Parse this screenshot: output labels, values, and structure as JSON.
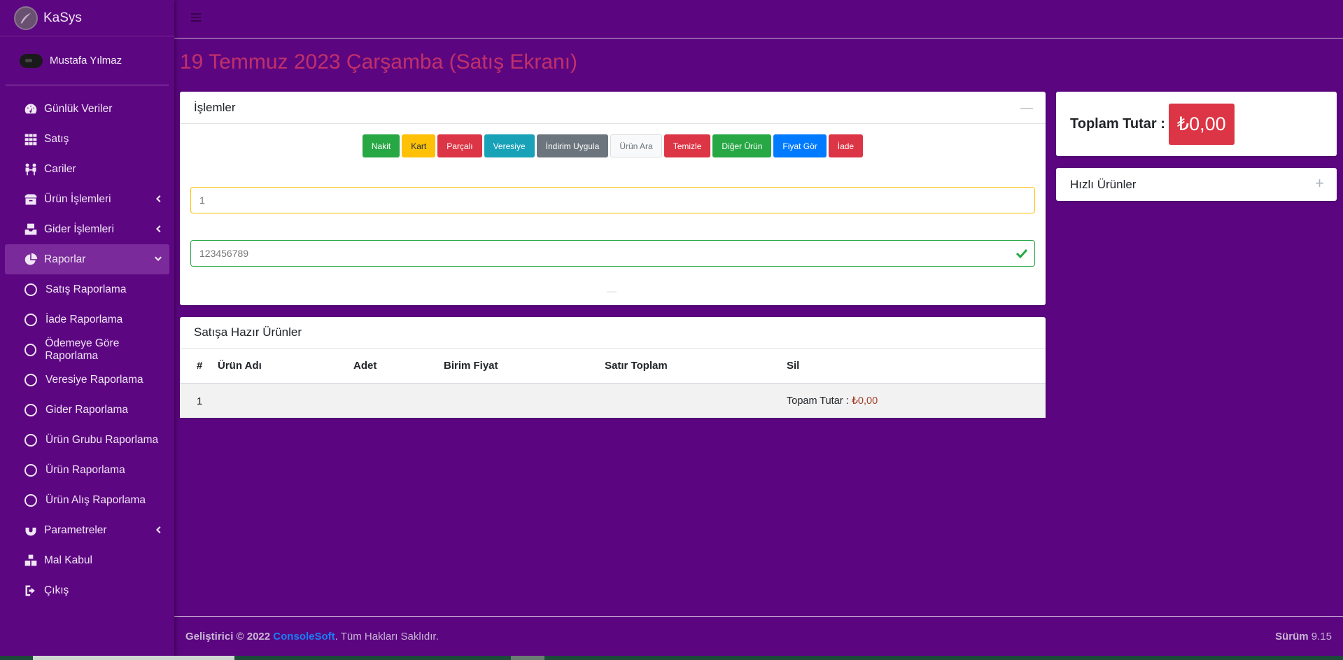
{
  "brand": {
    "name": "KaSys"
  },
  "user": {
    "name": "Mustafa Yılmaz"
  },
  "nav": [
    {
      "label": "Günlük Veriler",
      "icon": "dashboard-icon"
    },
    {
      "label": "Satış",
      "icon": "grid-icon"
    },
    {
      "label": "Cariler",
      "icon": "people-icon"
    },
    {
      "label": "Ürün İşlemleri",
      "icon": "box-icon",
      "has_children": true
    },
    {
      "label": "Gider İşlemleri",
      "icon": "tray-icon",
      "has_children": true
    },
    {
      "label": "Raporlar",
      "icon": "pie-chart-icon",
      "active": true,
      "expanded": true
    },
    {
      "label": "Satış Raporlama",
      "icon": "circle-icon"
    },
    {
      "label": "İade Raporlama",
      "icon": "circle-icon"
    },
    {
      "label": "Ödemeye Göre Raporlama",
      "icon": "circle-icon"
    },
    {
      "label": "Veresiye Raporlama",
      "icon": "circle-icon"
    },
    {
      "label": "Gider Raporlama",
      "icon": "circle-icon"
    },
    {
      "label": "Ürün Grubu Raporlama",
      "icon": "circle-icon"
    },
    {
      "label": "Ürün Raporlama",
      "icon": "circle-icon"
    },
    {
      "label": "Ürün Alış Raporlama",
      "icon": "circle-icon"
    },
    {
      "label": "Parametreler",
      "icon": "magnet-icon",
      "has_children": true
    },
    {
      "label": "Mal Kabul",
      "icon": "boxes-icon"
    },
    {
      "label": "Çıkış",
      "icon": "sign-out-icon"
    }
  ],
  "page": {
    "title": "19 Temmuz 2023 Çarşamba (Satış Ekranı)"
  },
  "islemler": {
    "title": "İşlemler",
    "buttons": [
      {
        "label": "Nakit",
        "style": "success"
      },
      {
        "label": "Kart",
        "style": "warning"
      },
      {
        "label": "Parçalı",
        "style": "danger"
      },
      {
        "label": "Veresiye",
        "style": "info"
      },
      {
        "label": "İndirim Uygula",
        "style": "secondary"
      },
      {
        "label": "Ürün Ara",
        "style": "light"
      },
      {
        "label": "Temizle",
        "style": "danger"
      },
      {
        "label": "Diğer Ürün",
        "style": "success"
      },
      {
        "label": "Fiyat Gör",
        "style": "primary"
      },
      {
        "label": "İade",
        "style": "danger"
      }
    ],
    "quantity_placeholder": "1",
    "barcode_placeholder": "123456789"
  },
  "ready_products": {
    "title": "Satışa Hazır Ürünler",
    "columns": [
      "#",
      "Ürün Adı",
      "Adet",
      "Birim Fiyat",
      "Satır Toplam",
      "Sil"
    ],
    "row_index": "1",
    "total_label": "Topam Tutar : ",
    "total_value": "₺0,00"
  },
  "total": {
    "label": "Toplam Tutar :",
    "value": "₺0,00"
  },
  "quick_products": {
    "title": "Hızlı Ürünler"
  },
  "footer": {
    "prefix": "Geliştirici © 2022 ",
    "company": "ConsoleSoft",
    "suffix": ". Tüm Hakları Saklıdır.",
    "version_label": "Sürüm",
    "version": " 9.15"
  },
  "colors": {
    "sidebar": "#5d0682",
    "background": "#5b0680",
    "title": "#c0306a",
    "accent_danger": "#dc3545"
  }
}
